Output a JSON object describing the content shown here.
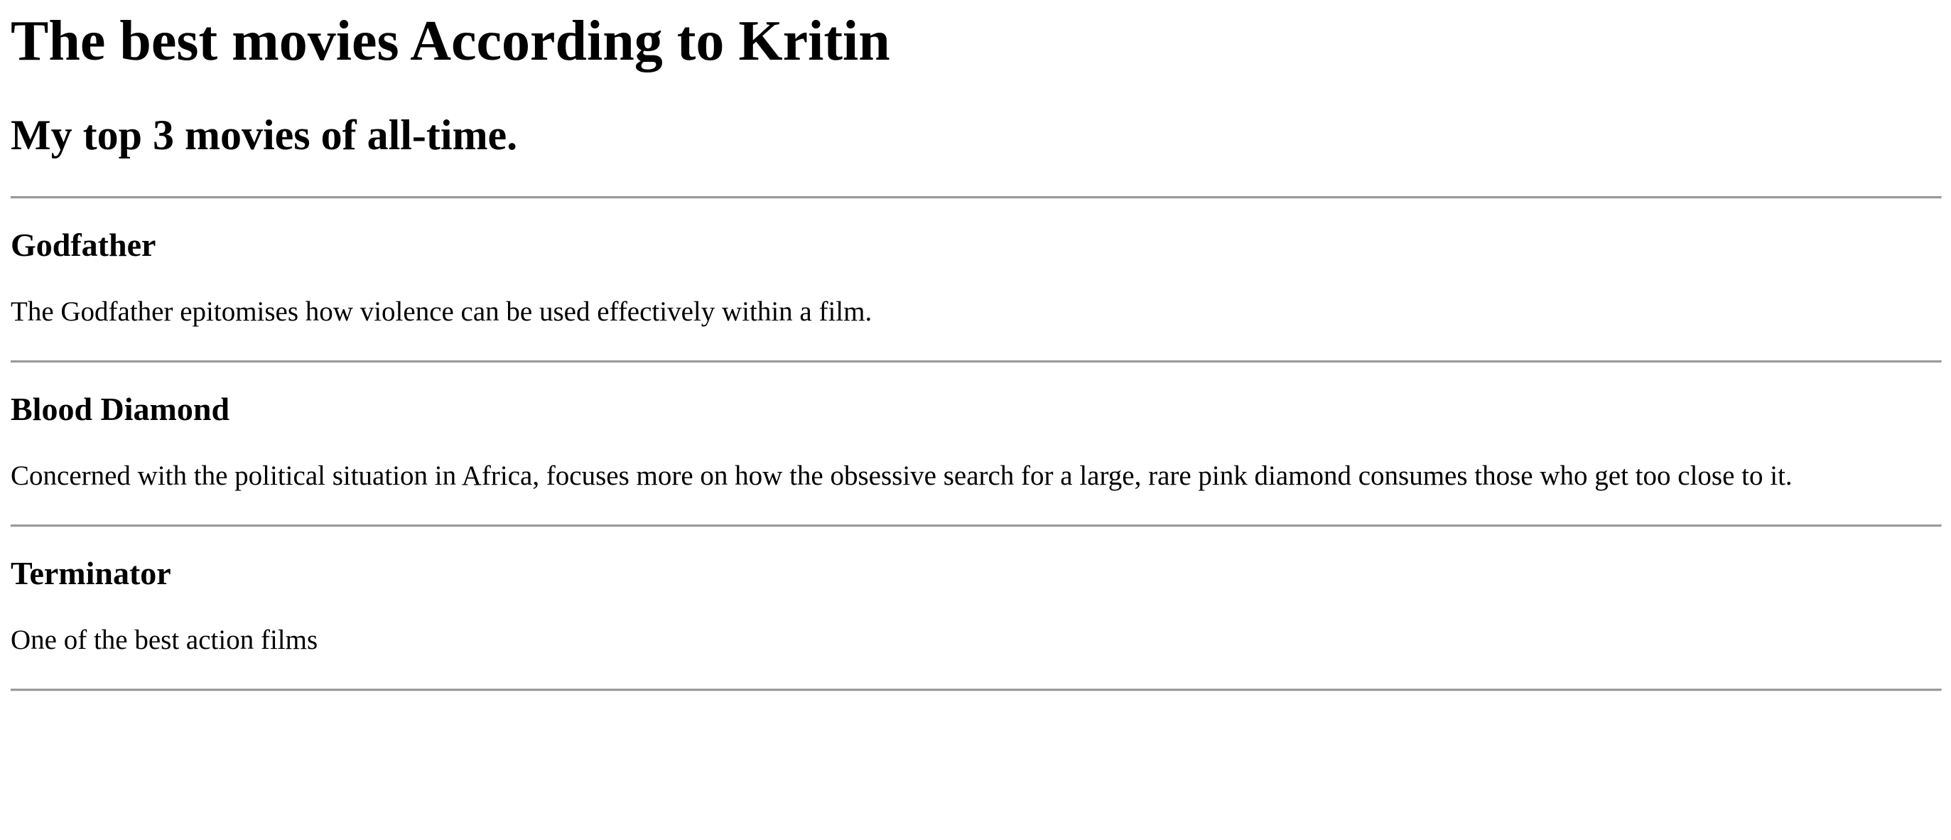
{
  "header": {
    "title": "The best movies According to Kritin",
    "subtitle": "My top 3 movies of all-time."
  },
  "movies": [
    {
      "title": "Godfather",
      "description": "The Godfather epitomises how violence can be used effectively within a film."
    },
    {
      "title": "Blood Diamond",
      "description": "Concerned with the political situation in Africa, focuses more on how the obsessive search for a large, rare pink diamond consumes those who get too close to it."
    },
    {
      "title": "Terminator",
      "description": "One of the best action films"
    }
  ],
  "colors": {
    "text": "#000000",
    "background": "#ffffff",
    "divider": "#9a9a9a"
  }
}
